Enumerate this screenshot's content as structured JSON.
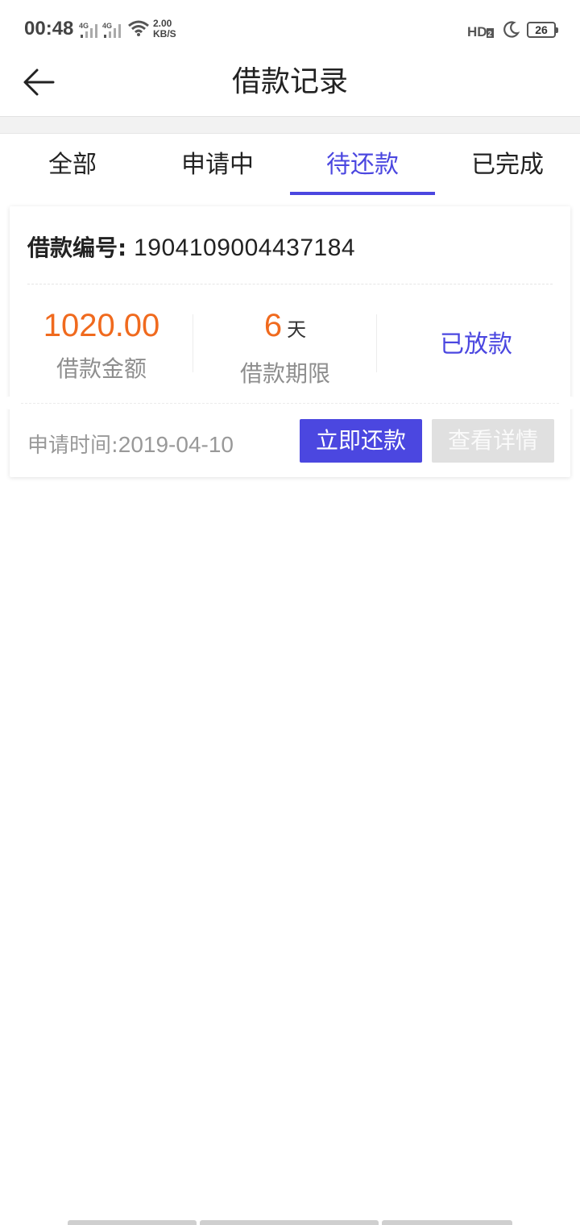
{
  "status_bar": {
    "time": "00:48",
    "sim1": "4G",
    "sim2": "4G",
    "speed_value": "2.00",
    "speed_unit": "KB/S",
    "hd_label": "HD",
    "hd_sub": "2",
    "battery": "26"
  },
  "header": {
    "title": "借款记录",
    "back_icon": "arrow-left-icon"
  },
  "tabs": [
    {
      "label": "全部",
      "active": false
    },
    {
      "label": "申请中",
      "active": false
    },
    {
      "label": "待还款",
      "active": true
    },
    {
      "label": "已完成",
      "active": false
    }
  ],
  "loan": {
    "number_label": "借款编号:",
    "number": "1904109004437184",
    "amount": "1020.00",
    "amount_label": "借款金额",
    "term_value": "6",
    "term_unit": "天",
    "term_label": "借款期限",
    "status": "已放款",
    "apply_time_label": "申请时间:",
    "apply_time": "2019-04-10",
    "repay_button": "立即还款",
    "detail_button": "查看详情"
  },
  "colors": {
    "accent": "#4b47e0",
    "amount": "#f06a1e",
    "muted": "#999999",
    "disabled_button": "#e0e0e0"
  }
}
